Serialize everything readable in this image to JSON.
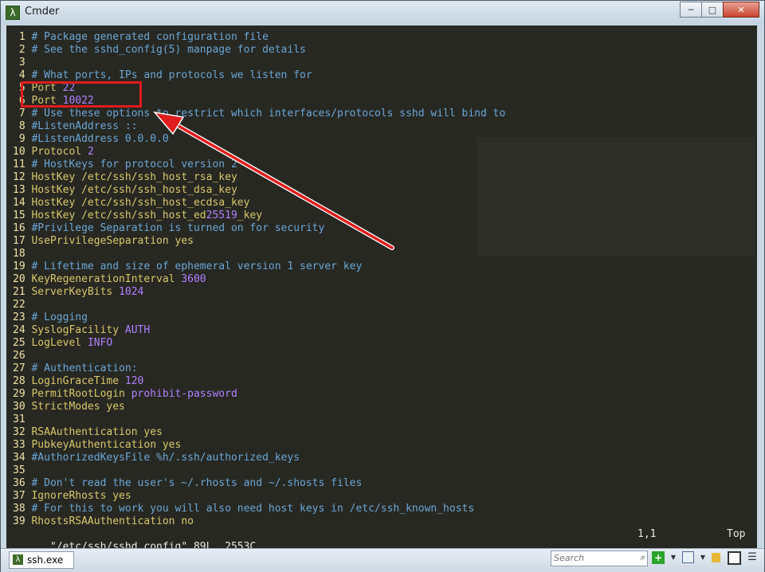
{
  "window": {
    "title": "Cmder",
    "app_icon": "λ",
    "min_label": "─",
    "max_label": "□",
    "close_label": "✕"
  },
  "colors": {
    "comment": "#6ba6d6",
    "keyword": "#d8c86a",
    "value": "#ae81ff",
    "line_number": "#f0e3a4",
    "background": "#272822",
    "annotation": "#e01c1c"
  },
  "editor": {
    "lines": [
      [
        {
          "t": "c",
          "v": "# Package generated configuration file"
        }
      ],
      [
        {
          "t": "c",
          "v": "# See the sshd_config(5) manpage for details"
        }
      ],
      [],
      [
        {
          "t": "c",
          "v": "# What ports, IPs and protocols we listen for"
        }
      ],
      [
        {
          "t": "k",
          "v": "Port "
        },
        {
          "t": "v",
          "v": "22"
        }
      ],
      [
        {
          "t": "k",
          "v": "Port "
        },
        {
          "t": "v",
          "v": "10022"
        }
      ],
      [
        {
          "t": "c",
          "v": "# Use these options to restrict which interfaces/protocols sshd will bind to"
        }
      ],
      [
        {
          "t": "c",
          "v": "#ListenAddress ::"
        }
      ],
      [
        {
          "t": "c",
          "v": "#ListenAddress 0.0.0.0"
        }
      ],
      [
        {
          "t": "k",
          "v": "Protocol "
        },
        {
          "t": "v",
          "v": "2"
        }
      ],
      [
        {
          "t": "c",
          "v": "# HostKeys for protocol version 2"
        }
      ],
      [
        {
          "t": "k",
          "v": "HostKey /etc/ssh/ssh_host_rsa_key"
        }
      ],
      [
        {
          "t": "k",
          "v": "HostKey /etc/ssh/ssh_host_dsa_key"
        }
      ],
      [
        {
          "t": "k",
          "v": "HostKey /etc/ssh/ssh_host_ecdsa_key"
        }
      ],
      [
        {
          "t": "k",
          "v": "HostKey /etc/ssh/ssh_host_ed"
        },
        {
          "t": "v",
          "v": "25519"
        },
        {
          "t": "k",
          "v": "_key"
        }
      ],
      [
        {
          "t": "c",
          "v": "#Privilege Separation is turned on for security"
        }
      ],
      [
        {
          "t": "k",
          "v": "UsePrivilegeSeparation "
        },
        {
          "t": "k",
          "v": "yes"
        }
      ],
      [],
      [
        {
          "t": "c",
          "v": "# Lifetime and size of ephemeral version 1 server key"
        }
      ],
      [
        {
          "t": "k",
          "v": "KeyRegenerationInterval "
        },
        {
          "t": "v",
          "v": "3600"
        }
      ],
      [
        {
          "t": "k",
          "v": "ServerKeyBits "
        },
        {
          "t": "v",
          "v": "1024"
        }
      ],
      [],
      [
        {
          "t": "c",
          "v": "# Logging"
        }
      ],
      [
        {
          "t": "k",
          "v": "SyslogFacility "
        },
        {
          "t": "v",
          "v": "AUTH"
        }
      ],
      [
        {
          "t": "k",
          "v": "LogLevel "
        },
        {
          "t": "v",
          "v": "INFO"
        }
      ],
      [],
      [
        {
          "t": "c",
          "v": "# Authentication:"
        }
      ],
      [
        {
          "t": "k",
          "v": "LoginGraceTime "
        },
        {
          "t": "v",
          "v": "120"
        }
      ],
      [
        {
          "t": "k",
          "v": "PermitRootLogin "
        },
        {
          "t": "v",
          "v": "prohibit-password"
        }
      ],
      [
        {
          "t": "k",
          "v": "StrictModes "
        },
        {
          "t": "k",
          "v": "yes"
        }
      ],
      [],
      [
        {
          "t": "k",
          "v": "RSAAuthentication "
        },
        {
          "t": "k",
          "v": "yes"
        }
      ],
      [
        {
          "t": "k",
          "v": "PubkeyAuthentication "
        },
        {
          "t": "k",
          "v": "yes"
        }
      ],
      [
        {
          "t": "c",
          "v": "#AuthorizedKeysFile %h/.ssh/authorized_keys"
        }
      ],
      [],
      [
        {
          "t": "c",
          "v": "# Don't read the user's ~/.rhosts and ~/.shosts files"
        }
      ],
      [
        {
          "t": "k",
          "v": "IgnoreRhosts "
        },
        {
          "t": "k",
          "v": "yes"
        }
      ],
      [
        {
          "t": "c",
          "v": "# For this to work you will also need host keys in /etc/ssh_known_hosts"
        }
      ],
      [
        {
          "t": "k",
          "v": "RhostsRSAAuthentication "
        },
        {
          "t": "k",
          "v": "no"
        }
      ]
    ],
    "status": {
      "file": "\"/etc/ssh/sshd_config\" 89L, 2553C",
      "position": "1,1",
      "scroll": "Top"
    }
  },
  "bottombar": {
    "tab_label": "ssh.exe",
    "tab_icon": "λ",
    "search_placeholder": "Search",
    "search_icon": "magnifier-icon",
    "new_console_label": "+",
    "dropdown_label": "▼",
    "menu_label": "☰"
  }
}
